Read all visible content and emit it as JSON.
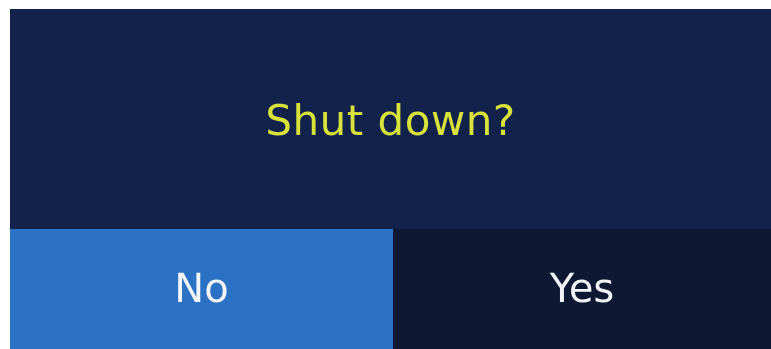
{
  "dialog": {
    "title": "Shut down?",
    "buttons": {
      "no_label": "No",
      "yes_label": "Yes"
    }
  },
  "colors": {
    "header_background": "#13224a",
    "title_text": "#d7e33a",
    "no_button_background": "#2b72c4",
    "yes_button_background": "#0e1833",
    "button_text": "#f2f4f8"
  }
}
